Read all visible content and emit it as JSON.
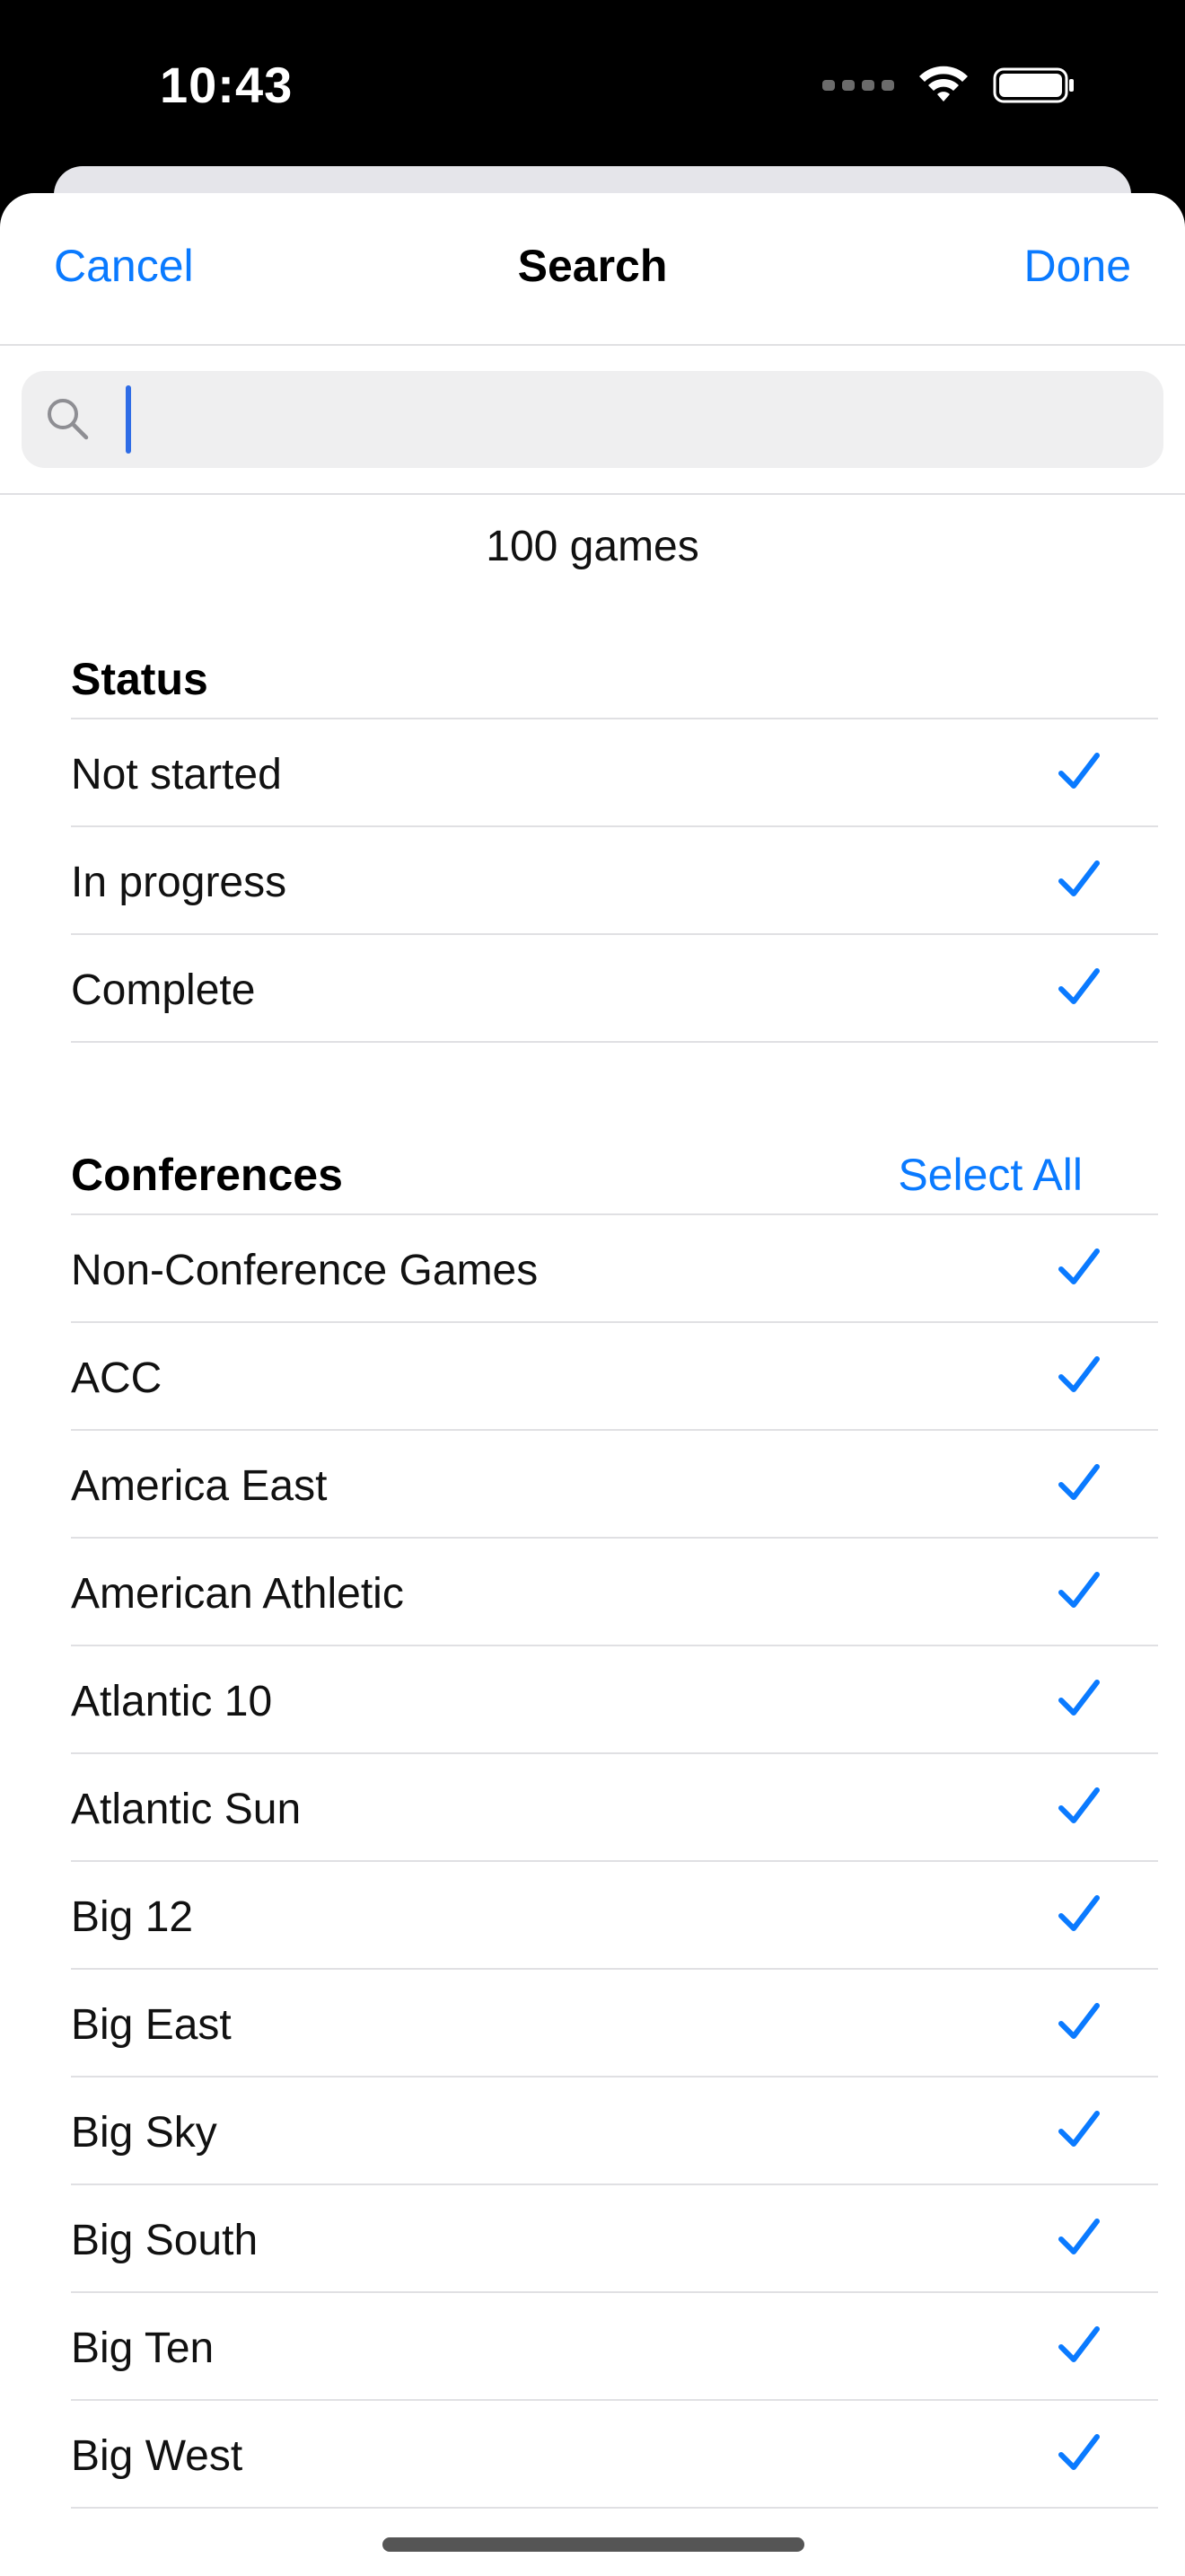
{
  "status_bar": {
    "time": "10:43"
  },
  "nav": {
    "cancel": "Cancel",
    "title": "Search",
    "done": "Done"
  },
  "search": {
    "value": "",
    "placeholder": ""
  },
  "count_text": "100 games",
  "colors": {
    "accent": "#0a7aff",
    "separator": "#e0e0e3",
    "search_bg": "#efeff0"
  },
  "status_section": {
    "title": "Status",
    "items": [
      {
        "label": "Not started",
        "checked": true
      },
      {
        "label": "In progress",
        "checked": true
      },
      {
        "label": "Complete",
        "checked": true
      }
    ]
  },
  "conferences_section": {
    "title": "Conferences",
    "select_all": "Select All",
    "items": [
      {
        "label": "Non-Conference Games",
        "checked": true
      },
      {
        "label": "ACC",
        "checked": true
      },
      {
        "label": "America East",
        "checked": true
      },
      {
        "label": "American Athletic",
        "checked": true
      },
      {
        "label": "Atlantic 10",
        "checked": true
      },
      {
        "label": "Atlantic Sun",
        "checked": true
      },
      {
        "label": "Big 12",
        "checked": true
      },
      {
        "label": "Big East",
        "checked": true
      },
      {
        "label": "Big Sky",
        "checked": true
      },
      {
        "label": "Big South",
        "checked": true
      },
      {
        "label": "Big Ten",
        "checked": true
      },
      {
        "label": "Big West",
        "checked": true
      }
    ]
  },
  "icons": {
    "search": "search-icon",
    "check": "checkmark-icon"
  }
}
